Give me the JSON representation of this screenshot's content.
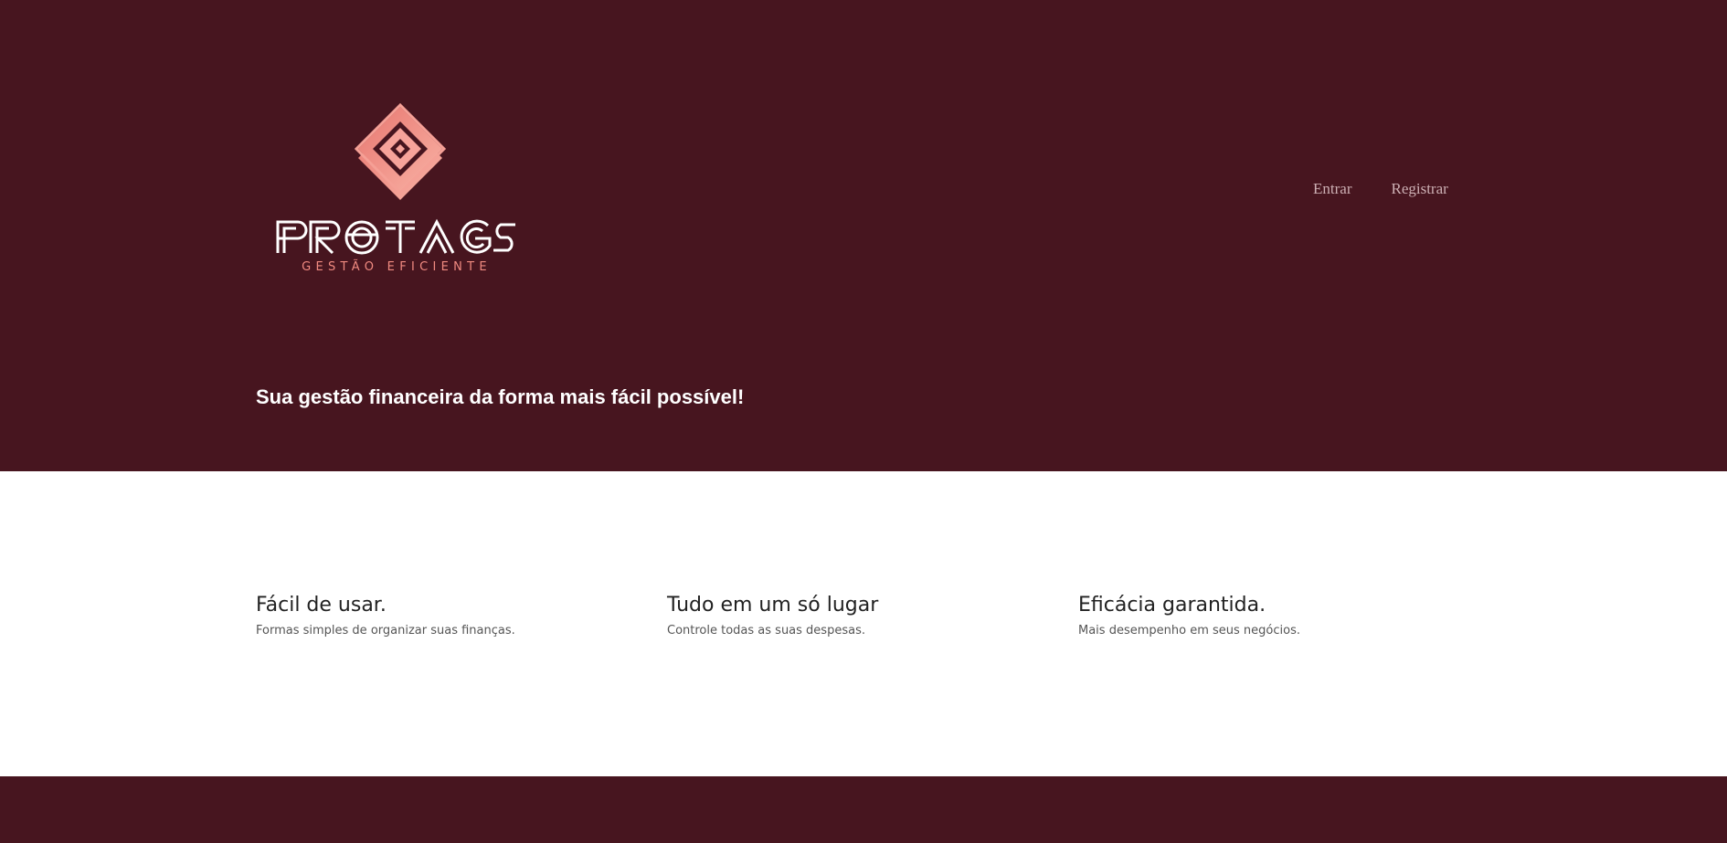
{
  "brand": {
    "logo_text": "PROTAGS",
    "tagline": "GESTÃO EFICIENTE",
    "icon": "diamond-logo-icon",
    "colors": {
      "primary": "#47151f",
      "accent_pink": "#f7a39a",
      "accent_coral": "#e8766f",
      "wordmark": "#ffffff"
    }
  },
  "nav": {
    "login_label": "Entrar",
    "register_label": "Registrar"
  },
  "hero": {
    "headline": "Sua gestão financeira da forma mais fácil possível!"
  },
  "features": [
    {
      "title": "Fácil de usar.",
      "description": "Formas simples de organizar suas finanças."
    },
    {
      "title": "Tudo em um só lugar",
      "description": "Controle todas as suas despesas."
    },
    {
      "title": "Eficácia garantida.",
      "description": "Mais desempenho em seus negócios."
    }
  ]
}
